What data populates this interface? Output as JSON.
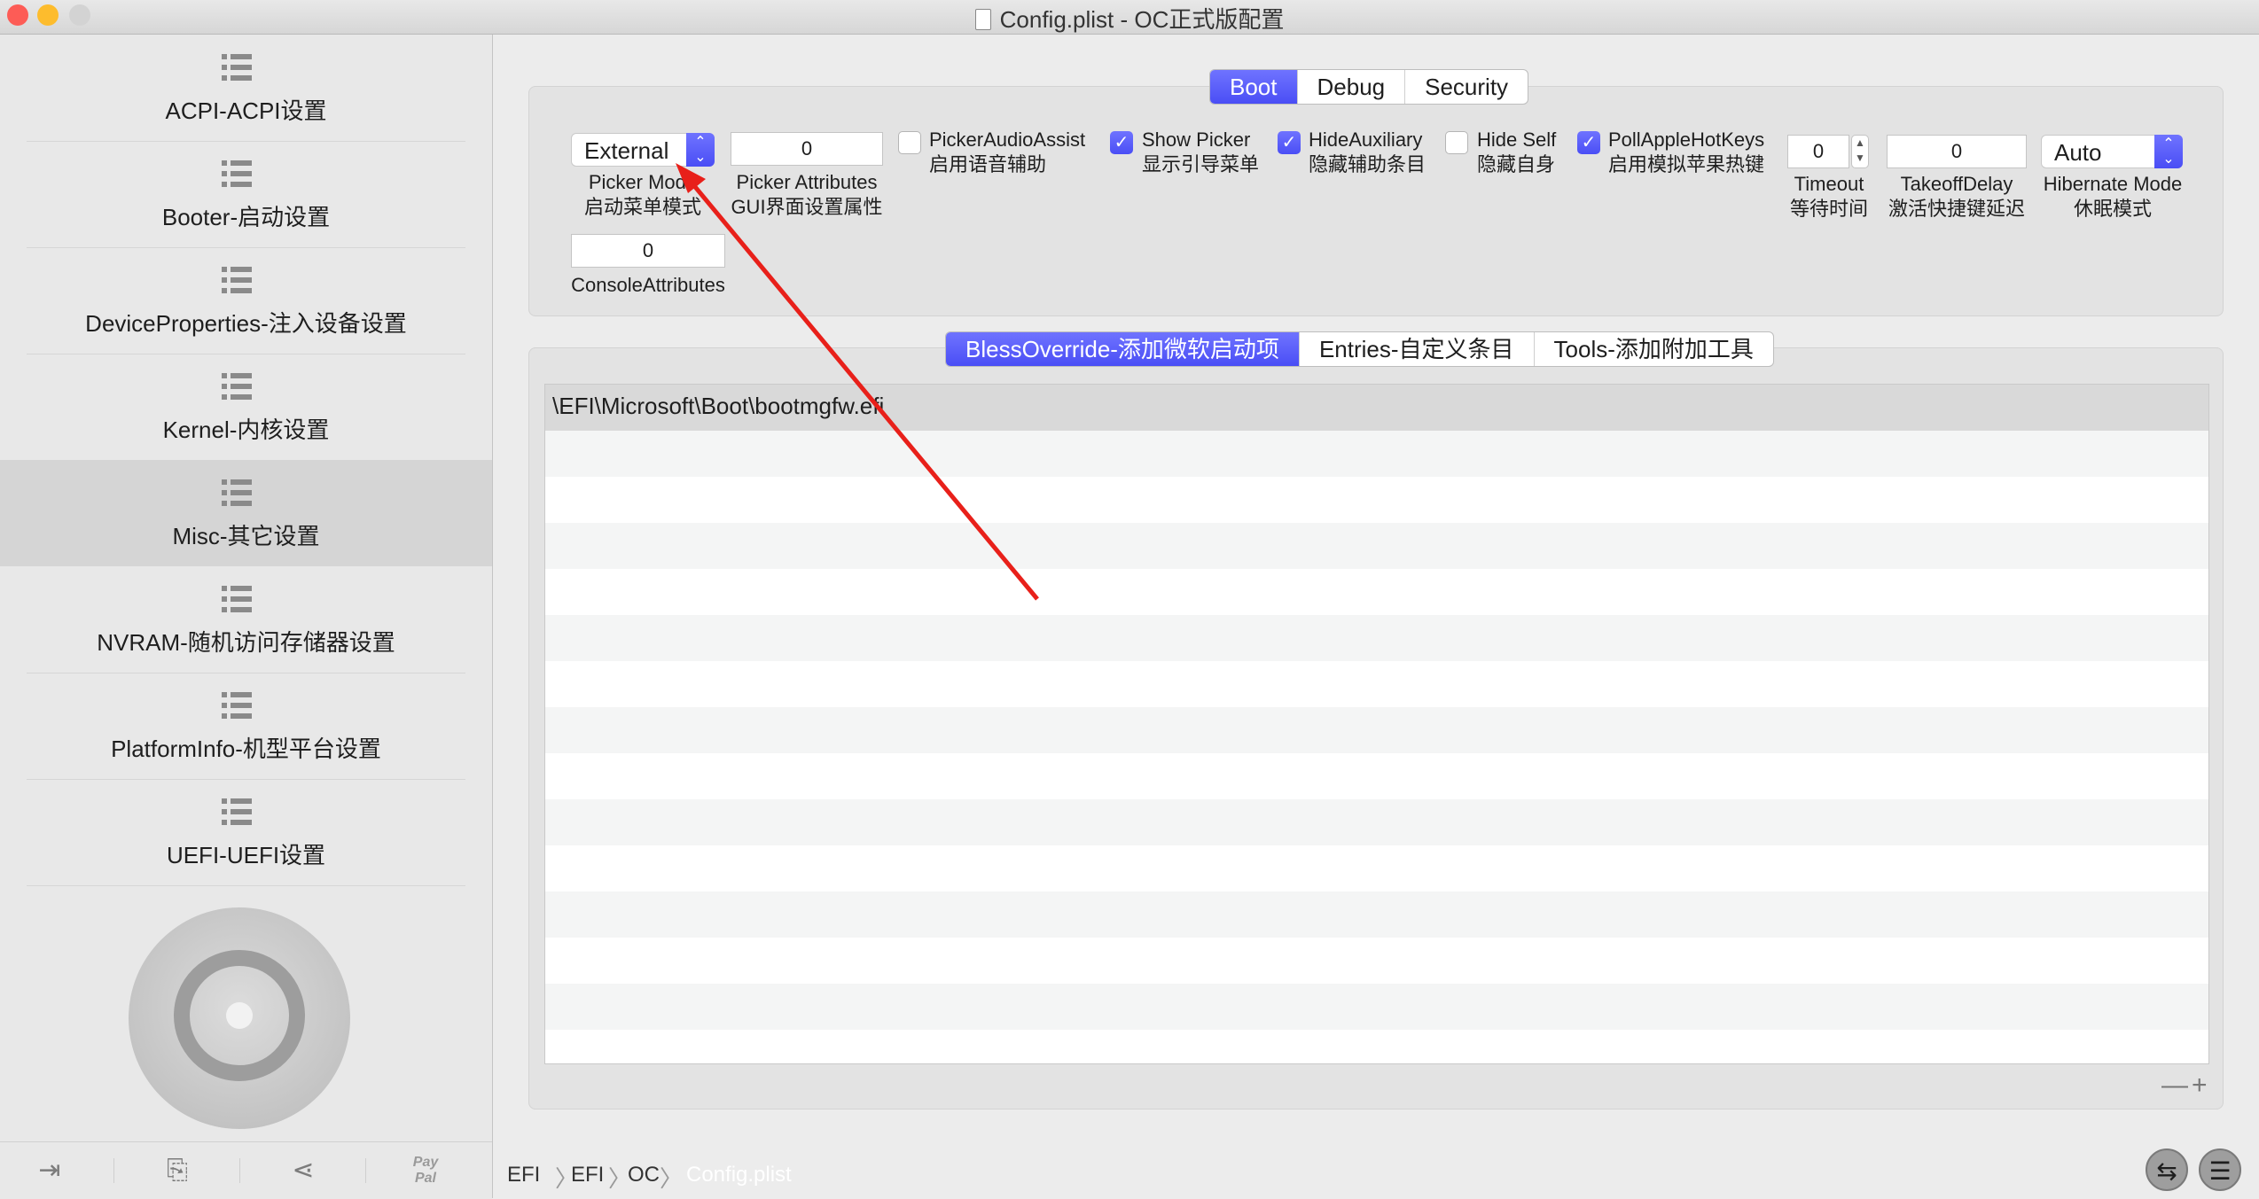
{
  "window": {
    "title": "Config.plist - OC正式版配置"
  },
  "sidebar": {
    "items": [
      {
        "label": "ACPI-ACPI设置",
        "selected": false
      },
      {
        "label": "Booter-启动设置",
        "selected": false
      },
      {
        "label": "DeviceProperties-注入设备设置",
        "selected": false
      },
      {
        "label": "Kernel-内核设置",
        "selected": false
      },
      {
        "label": "Misc-其它设置",
        "selected": true
      },
      {
        "label": "NVRAM-随机访问存储器设置",
        "selected": false
      },
      {
        "label": "PlatformInfo-机型平台设置",
        "selected": false
      },
      {
        "label": "UEFI-UEFI设置",
        "selected": false
      }
    ],
    "bottom_paypal": "Pay\nPal"
  },
  "top_tabs": [
    "Boot",
    "Debug",
    "Security"
  ],
  "top_tabs_selected": "Boot",
  "boot": {
    "picker_mode": {
      "value": "External",
      "label_en": "Picker Mode",
      "label_cn": "启动菜单模式"
    },
    "picker_attributes": {
      "value": "0",
      "label_en": "Picker Attributes",
      "label_cn": "GUI界面设置属性"
    },
    "console_attributes": {
      "value": "0",
      "label": "ConsoleAttributes"
    },
    "checkboxes": [
      {
        "label_en": "PickerAudioAssist",
        "label_cn": "启用语音辅助",
        "checked": false
      },
      {
        "label_en": "Show Picker",
        "label_cn": "显示引导菜单",
        "checked": true
      },
      {
        "label_en": "HideAuxiliary",
        "label_cn": "隐藏辅助条目",
        "checked": true
      },
      {
        "label_en": "Hide Self",
        "label_cn": "隐藏自身",
        "checked": false
      },
      {
        "label_en": "PollAppleHotKeys",
        "label_cn": "启用模拟苹果热键",
        "checked": true
      }
    ],
    "timeout": {
      "value": "0",
      "label_en": "Timeout",
      "label_cn": "等待时间"
    },
    "takeoff_delay": {
      "value": "0",
      "label_en": "TakeoffDelay",
      "label_cn": "激活快捷键延迟"
    },
    "hibernate_mode": {
      "value": "Auto",
      "label_en": "Hibernate Mode",
      "label_cn": "休眠模式"
    }
  },
  "sub_tabs": [
    "BlessOverride-添加微软启动项",
    "Entries-自定义条目",
    "Tools-添加附加工具"
  ],
  "sub_tabs_selected": "BlessOverride-添加微软启动项",
  "table": {
    "rows": [
      "\\EFI\\Microsoft\\Boot\\bootmgfw.efi"
    ]
  },
  "table_controls": {
    "remove": "—",
    "add": "+"
  },
  "pathbar": [
    "EFI",
    "EFI",
    "OC",
    "Config.plist"
  ],
  "colors": {
    "accent": "#5458f7",
    "arrow": "#e8201a"
  }
}
